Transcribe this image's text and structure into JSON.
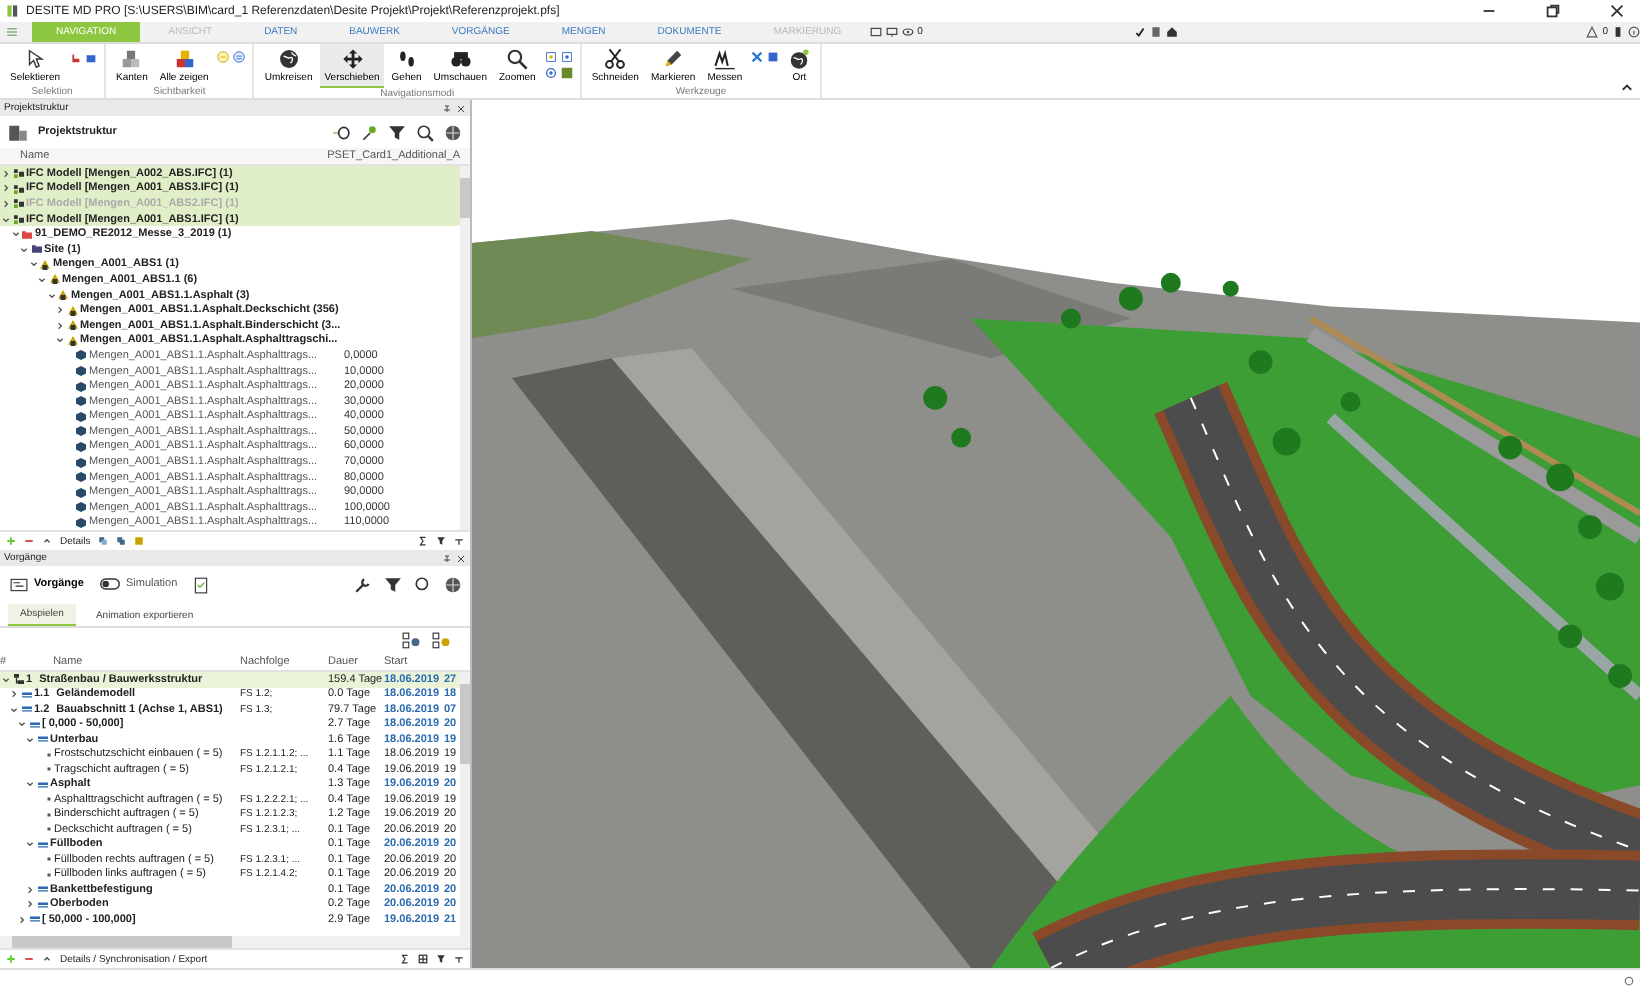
{
  "window": {
    "title": "DESITE MD PRO [S:\\USERS\\BIM\\card_1 Referenzdaten\\Desite Projekt\\Projekt\\Referenzprojekt.pfs]"
  },
  "ribbon_tabs": [
    {
      "label": "NAVIGATION",
      "selected": true,
      "disabled": false
    },
    {
      "label": "ANSICHT",
      "selected": false,
      "disabled": true
    },
    {
      "label": "DATEN",
      "selected": false,
      "disabled": false
    },
    {
      "label": "BAUWERK",
      "selected": false,
      "disabled": false
    },
    {
      "label": "VORGÄNGE",
      "selected": false,
      "disabled": false
    },
    {
      "label": "MENGEN",
      "selected": false,
      "disabled": false
    },
    {
      "label": "DOKUMENTE",
      "selected": false,
      "disabled": false
    },
    {
      "label": "MARKIERUNG",
      "selected": false,
      "disabled": true
    }
  ],
  "view_counter": "0",
  "warning_counter": "0",
  "ribbon_groups": [
    {
      "label": "Selektion",
      "buttons": [
        {
          "label": "Selektieren",
          "selected": false
        }
      ]
    },
    {
      "label": "Sichtbarkeit",
      "buttons": [
        {
          "label": "Kanten",
          "selected": false
        },
        {
          "label": "Alle zeigen",
          "selected": false
        }
      ]
    },
    {
      "label": "Navigationsmodi",
      "buttons": [
        {
          "label": "Umkreisen",
          "selected": false
        },
        {
          "label": "Verschieben",
          "selected": true
        },
        {
          "label": "Gehen",
          "selected": false
        },
        {
          "label": "Umschauen",
          "selected": false
        },
        {
          "label": "Zoomen",
          "selected": false
        }
      ]
    },
    {
      "label": "Werkzeuge",
      "buttons": [
        {
          "label": "Schneiden",
          "selected": false
        },
        {
          "label": "Markieren",
          "selected": false
        },
        {
          "label": "Messen",
          "selected": false
        },
        {
          "label": "Ort",
          "selected": false
        }
      ]
    }
  ],
  "project_panel": {
    "title": "Projektstruktur",
    "toolbar_label": "Projektstruktur",
    "columns": [
      "Name",
      "PSET_Card1_Additional_A"
    ],
    "tree": [
      {
        "kind": "model",
        "label": "IFC Modell [Mengen_A002_ABS.IFC] (1)",
        "highlighted": true,
        "disabled": false,
        "expanded": false
      },
      {
        "kind": "model",
        "label": "IFC Modell [Mengen_A001_ABS3.IFC] (1)",
        "highlighted": true,
        "disabled": false,
        "expanded": false
      },
      {
        "kind": "model",
        "label": "IFC Modell [Mengen_A001_ABS2.IFC] (1)",
        "highlighted": true,
        "disabled": true,
        "expanded": false
      },
      {
        "kind": "model",
        "label": "IFC Modell [Mengen_A001_ABS1.IFC] (1)",
        "highlighted": true,
        "disabled": false,
        "expanded": true,
        "children": [
          {
            "kind": "project",
            "label": "91_DEMO_RE2012_Messe_3_2019 (1)",
            "expanded": true,
            "children": [
              {
                "kind": "site",
                "label": "Site (1)",
                "expanded": true,
                "children": [
                  {
                    "kind": "part",
                    "label": "Mengen_A001_ABS1 (1)",
                    "expanded": true,
                    "children": [
                      {
                        "kind": "part",
                        "label": "Mengen_A001_ABS1.1 (6)",
                        "expanded": true,
                        "children": [
                          {
                            "kind": "part",
                            "label": "Mengen_A001_ABS1.1.Asphalt (3)",
                            "expanded": true,
                            "children": [
                              {
                                "kind": "part",
                                "label": "Mengen_A001_ABS1.1.Asphalt.Deckschicht (356)",
                                "expanded": false
                              },
                              {
                                "kind": "part",
                                "label": "Mengen_A001_ABS1.1.Asphalt.Binderschicht (3...",
                                "expanded": false
                              },
                              {
                                "kind": "part",
                                "label": "Mengen_A001_ABS1.1.Asphalt.Asphalttragschi...",
                                "expanded": true,
                                "children": [
                                  {
                                    "kind": "element",
                                    "label": "Mengen_A001_ABS1.1.Asphalt.Asphalttrags...",
                                    "value": "0,0000"
                                  },
                                  {
                                    "kind": "element",
                                    "label": "Mengen_A001_ABS1.1.Asphalt.Asphalttrags...",
                                    "value": "10,0000"
                                  },
                                  {
                                    "kind": "element",
                                    "label": "Mengen_A001_ABS1.1.Asphalt.Asphalttrags...",
                                    "value": "20,0000"
                                  },
                                  {
                                    "kind": "element",
                                    "label": "Mengen_A001_ABS1.1.Asphalt.Asphalttrags...",
                                    "value": "30,0000"
                                  },
                                  {
                                    "kind": "element",
                                    "label": "Mengen_A001_ABS1.1.Asphalt.Asphalttrags...",
                                    "value": "40,0000"
                                  },
                                  {
                                    "kind": "element",
                                    "label": "Mengen_A001_ABS1.1.Asphalt.Asphalttrags...",
                                    "value": "50,0000"
                                  },
                                  {
                                    "kind": "element",
                                    "label": "Mengen_A001_ABS1.1.Asphalt.Asphalttrags...",
                                    "value": "60,0000"
                                  },
                                  {
                                    "kind": "element",
                                    "label": "Mengen_A001_ABS1.1.Asphalt.Asphalttrags...",
                                    "value": "70,0000"
                                  },
                                  {
                                    "kind": "element",
                                    "label": "Mengen_A001_ABS1.1.Asphalt.Asphalttrags...",
                                    "value": "80,0000"
                                  },
                                  {
                                    "kind": "element",
                                    "label": "Mengen_A001_ABS1.1.Asphalt.Asphalttrags...",
                                    "value": "90,0000"
                                  },
                                  {
                                    "kind": "element",
                                    "label": "Mengen_A001_ABS1.1.Asphalt.Asphalttrags...",
                                    "value": "100,0000"
                                  },
                                  {
                                    "kind": "element",
                                    "label": "Mengen_A001_ABS1.1.Asphalt.Asphalttrags...",
                                    "value": "110,0000"
                                  }
                                ]
                              }
                            ]
                          }
                        ]
                      }
                    ]
                  }
                ]
              }
            ]
          }
        ]
      }
    ],
    "footer_label": "Details"
  },
  "tasks_panel": {
    "title": "Vorgänge",
    "tasks_button": "Vorgänge",
    "simulation_label": "Simulation",
    "simulation_on": false,
    "tabs": [
      {
        "label": "Abspielen",
        "selected": true
      },
      {
        "label": "Animation exportieren",
        "selected": false
      }
    ],
    "columns": [
      "#",
      "Name",
      "Nachfolge",
      "Dauer",
      "Start"
    ],
    "rows": [
      {
        "kind": "root",
        "number": "1",
        "name": "Straßenbau / Bauwerksstruktur",
        "successor": "",
        "duration": "159.4 Tage",
        "start": "18.06.2019",
        "column_6": "27",
        "highlighted": true,
        "expanded": true,
        "children": [
          {
            "kind": "summary",
            "number": "1.1",
            "name": "Geländemodell",
            "successor": "FS 1.2;",
            "duration": "0.0 Tage",
            "start": "18.06.2019",
            "column_6": "18",
            "highlighted": false,
            "expanded": false
          },
          {
            "kind": "summary",
            "number": "1.2",
            "name": "Bauabschnitt 1 (Achse 1, ABS1)",
            "successor": "FS 1.3;",
            "duration": "79.7 Tage",
            "start": "18.06.2019",
            "column_6": "07",
            "highlighted": false,
            "expanded": true,
            "children": [
              {
                "kind": "summary",
                "name": "[ 0,000 - 50,000]",
                "duration": "2.7 Tage",
                "start": "18.06.2019",
                "column_6": "20",
                "expanded": true,
                "children": [
                  {
                    "kind": "summary",
                    "name": "Unterbau",
                    "duration": "1.6 Tage",
                    "start": "18.06.2019",
                    "column_6": "19",
                    "expanded": true,
                    "children": [
                      {
                        "kind": "task",
                        "name": "Frostschutzschicht einbauen ( = 5)",
                        "successor": "FS 1.2.1.1.2; ...",
                        "duration": "1.1 Tage",
                        "start": "18.06.2019",
                        "column_6": "19"
                      },
                      {
                        "kind": "task",
                        "name": "Tragschicht auftragen ( = 5)",
                        "successor": "FS 1.2.1.2.1;",
                        "duration": "0.4 Tage",
                        "start": "19.06.2019",
                        "column_6": "19"
                      }
                    ]
                  },
                  {
                    "kind": "summary",
                    "name": "Asphalt",
                    "duration": "1.3 Tage",
                    "start": "19.06.2019",
                    "column_6": "20",
                    "expanded": true,
                    "children": [
                      {
                        "kind": "task",
                        "name": "Asphalttragschicht auftragen ( = 5)",
                        "successor": "FS 1.2.2.2.1; ...",
                        "duration": "0.4 Tage",
                        "start": "19.06.2019",
                        "column_6": "19"
                      },
                      {
                        "kind": "task",
                        "name": "Binderschicht auftragen ( = 5)",
                        "successor": "FS 1.2.1.2.3;",
                        "duration": "1.2 Tage",
                        "start": "19.06.2019",
                        "column_6": "20"
                      },
                      {
                        "kind": "task",
                        "name": "Deckschicht auftragen ( = 5)",
                        "successor": "FS 1.2.3.1; ...",
                        "duration": "0.1 Tage",
                        "start": "20.06.2019",
                        "column_6": "20"
                      }
                    ]
                  },
                  {
                    "kind": "summary",
                    "name": "Füllboden",
                    "duration": "0.1 Tage",
                    "start": "20.06.2019",
                    "column_6": "20",
                    "expanded": true,
                    "children": [
                      {
                        "kind": "task",
                        "name": "Füllboden rechts auftragen ( = 5)",
                        "successor": "FS 1.2.3.1; ...",
                        "duration": "0.1 Tage",
                        "start": "20.06.2019",
                        "column_6": "20"
                      },
                      {
                        "kind": "task",
                        "name": "Füllboden links auftragen ( = 5)",
                        "successor": "FS 1.2.1.4.2;",
                        "duration": "0.1 Tage",
                        "start": "20.06.2019",
                        "column_6": "20"
                      }
                    ]
                  },
                  {
                    "kind": "summary",
                    "name": "Bankettbefestigung",
                    "duration": "0.1 Tage",
                    "start": "20.06.2019",
                    "column_6": "20",
                    "expanded": false
                  },
                  {
                    "kind": "summary",
                    "name": "Oberboden",
                    "duration": "0.2 Tage",
                    "start": "20.06.2019",
                    "column_6": "20",
                    "expanded": false
                  }
                ]
              },
              {
                "kind": "summary",
                "name": "[ 50,000 - 100,000]",
                "duration": "2.9 Tage",
                "start": "19.06.2019",
                "column_6": "21",
                "expanded": false
              }
            ]
          }
        ]
      }
    ],
    "footer_label": "Details / Synchronisation / Export"
  }
}
